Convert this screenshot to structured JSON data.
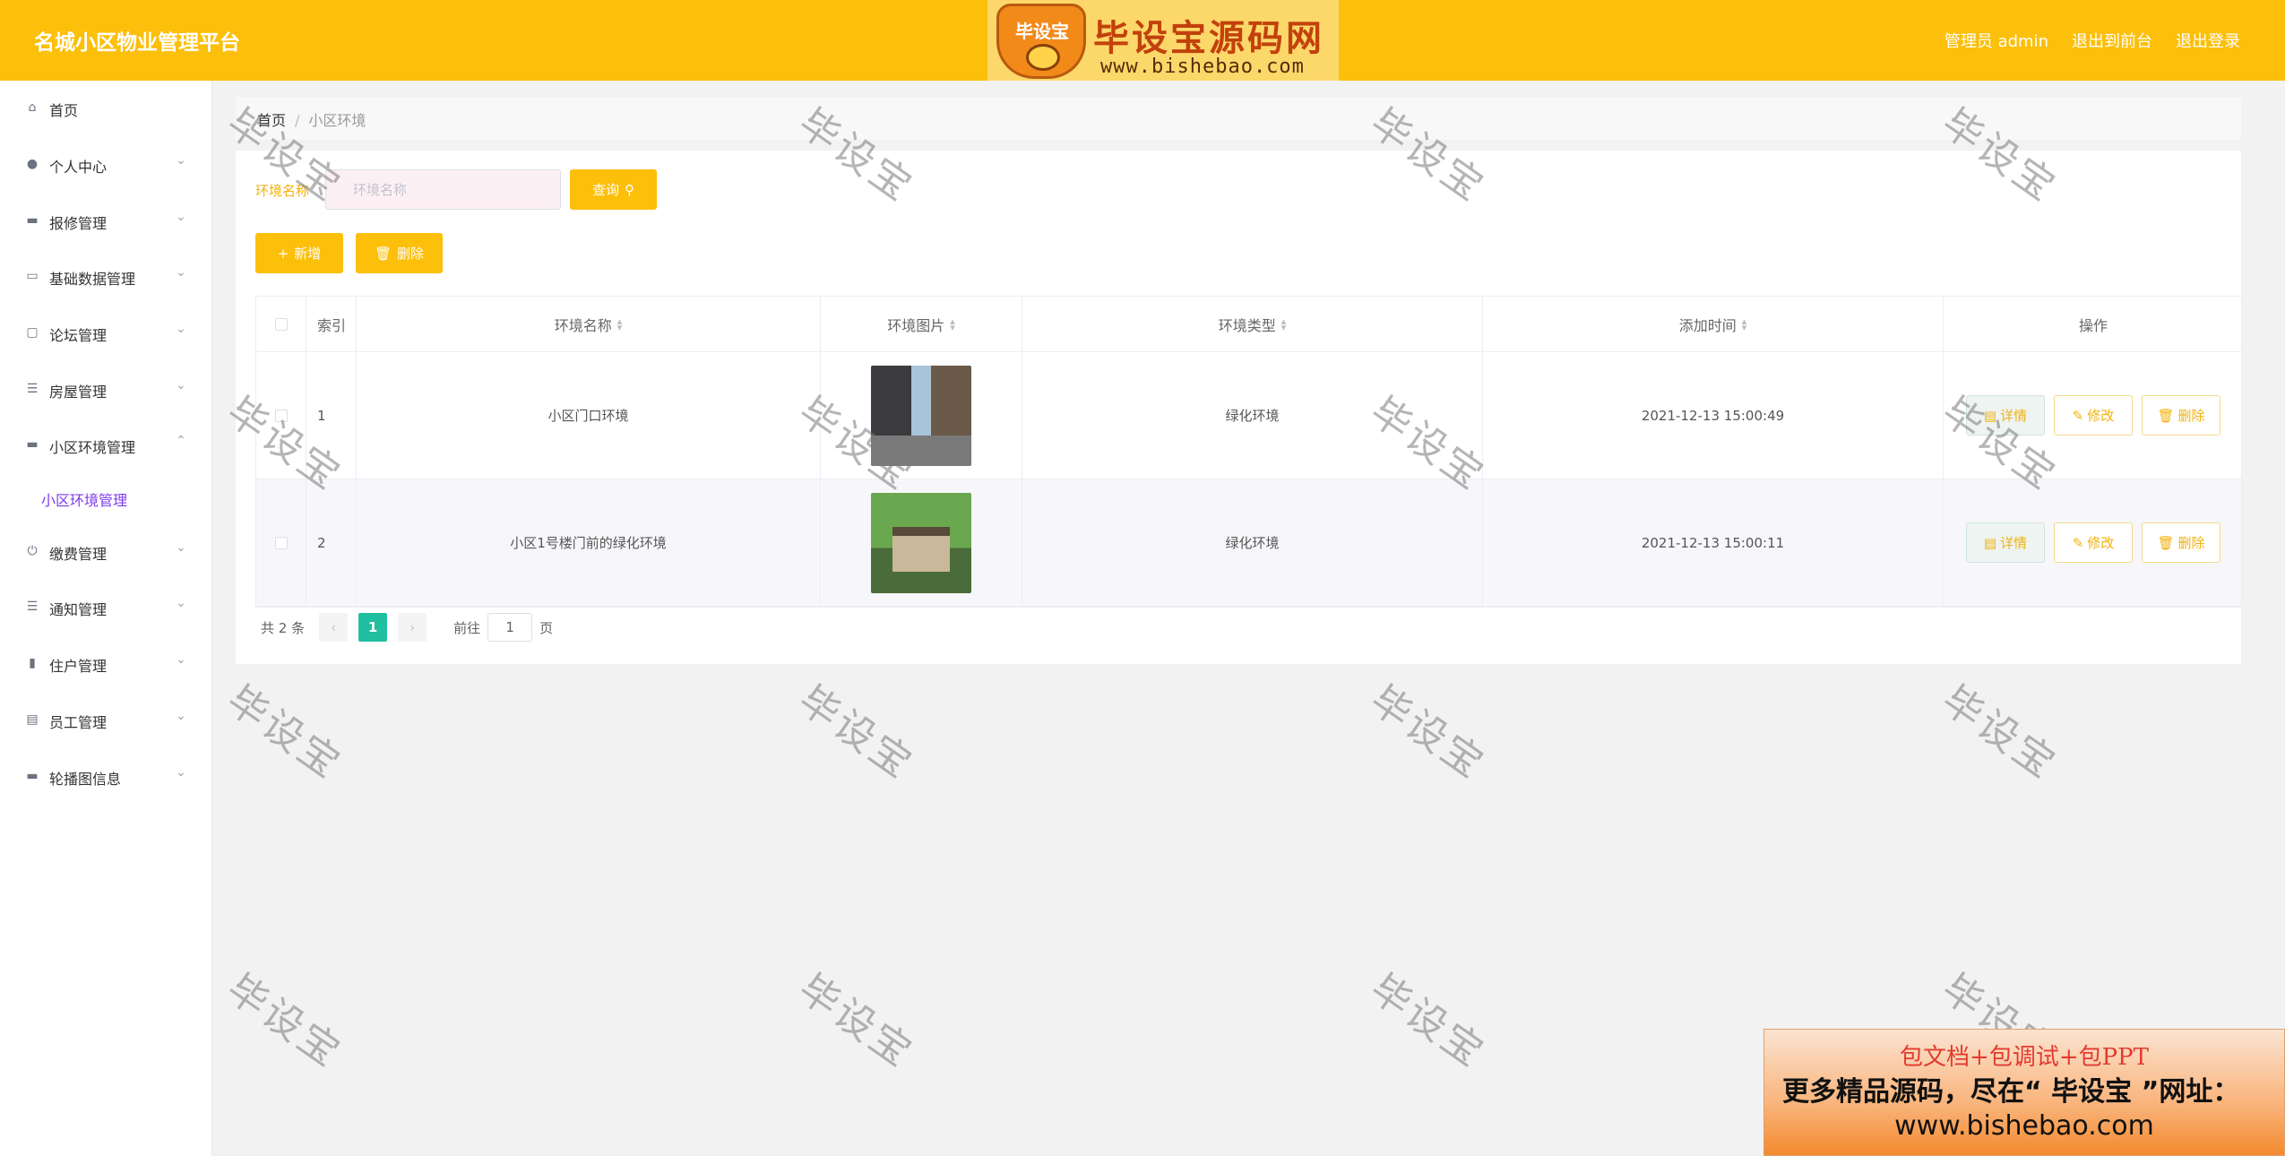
{
  "header": {
    "brand": "名城小区物业管理平台",
    "admin_label": "管理员 admin",
    "to_front": "退出到前台",
    "logout": "退出登录",
    "colors": {
      "header_bg": "#fcbf0a",
      "accent": "#fcbf0a",
      "active_page": "#1fbf9f",
      "submenu_active": "#7c3aed"
    }
  },
  "logo": {
    "badge": "毕设宝",
    "title": "毕设宝源码网",
    "url": "www.bishebao.com"
  },
  "sidebar": {
    "items": [
      {
        "label": "首页",
        "icon": "home-icon"
      },
      {
        "label": "个人中心",
        "icon": "user-icon"
      },
      {
        "label": "报修管理",
        "icon": "repair-icon"
      },
      {
        "label": "基础数据管理",
        "icon": "monitor-icon"
      },
      {
        "label": "论坛管理",
        "icon": "chat-icon"
      },
      {
        "label": "房屋管理",
        "icon": "list-icon"
      },
      {
        "label": "小区环境管理",
        "icon": "message-icon"
      },
      {
        "label": "缴费管理",
        "icon": "power-icon"
      },
      {
        "label": "通知管理",
        "icon": "list-icon"
      },
      {
        "label": "住户管理",
        "icon": "chart-icon"
      },
      {
        "label": "员工管理",
        "icon": "card-icon"
      },
      {
        "label": "轮播图信息",
        "icon": "banner-icon"
      }
    ],
    "sub_item": "小区环境管理"
  },
  "breadcrumb": {
    "home": "首页",
    "separator": "/",
    "current": "小区环境"
  },
  "search": {
    "label": "环境名称",
    "placeholder": "环境名称",
    "value": "",
    "button": "查询"
  },
  "actions": {
    "add": "新增",
    "delete": "删除"
  },
  "table": {
    "headers": {
      "index": "索引",
      "name": "环境名称",
      "image": "环境图片",
      "type": "环境类型",
      "time": "添加时间",
      "ops": "操作"
    },
    "rows": [
      {
        "index": "1",
        "name": "小区门口环境",
        "type": "绿化环境",
        "time": "2021-12-13 15:00:49"
      },
      {
        "index": "2",
        "name": "小区1号楼门前的绿化环境",
        "type": "绿化环境",
        "time": "2021-12-13 15:00:11"
      }
    ],
    "op_labels": {
      "detail": "详情",
      "edit": "修改",
      "delete": "删除"
    }
  },
  "pagination": {
    "total": "共 2 条",
    "current_page": "1",
    "goto_prefix": "前往",
    "goto_value": "1",
    "goto_suffix": "页"
  },
  "watermark": "毕设宝",
  "ad": {
    "line1": "包文档+包调试+包PPT",
    "line2": "更多精品源码，尽在“ 毕设宝 ”网址：",
    "line3": "www.bishebao.com"
  }
}
